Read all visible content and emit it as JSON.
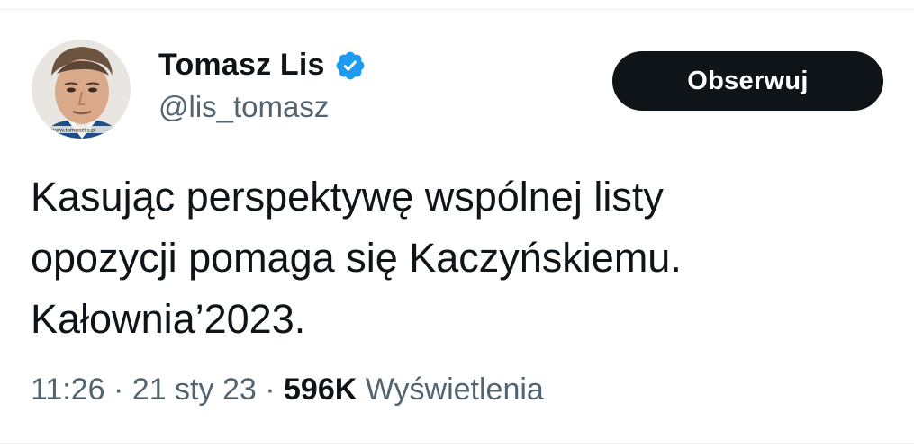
{
  "tweet": {
    "author": {
      "display_name": "Tomasz Lis",
      "handle": "@lis_tomasz",
      "verified": true,
      "verified_icon": "verified-badge-icon",
      "avatar_watermark": "www.tomaszlis.pl"
    },
    "follow_button": {
      "label": "Obserwuj"
    },
    "text": "Kasując perspektywę wspólnej listy\nopozycji pomaga się Kaczyńskiemu.\nKałownia’2023.",
    "meta": {
      "time": "11:26",
      "separator": "·",
      "date": "21 sty 23",
      "views_count": "596K",
      "views_label": "Wyświetlenia"
    }
  },
  "colors": {
    "text_primary": "#0f1419",
    "text_secondary": "#536471",
    "verified_blue": "#1d9bf0",
    "button_bg": "#0f1419",
    "button_text": "#ffffff",
    "divider": "#eff3f4"
  }
}
